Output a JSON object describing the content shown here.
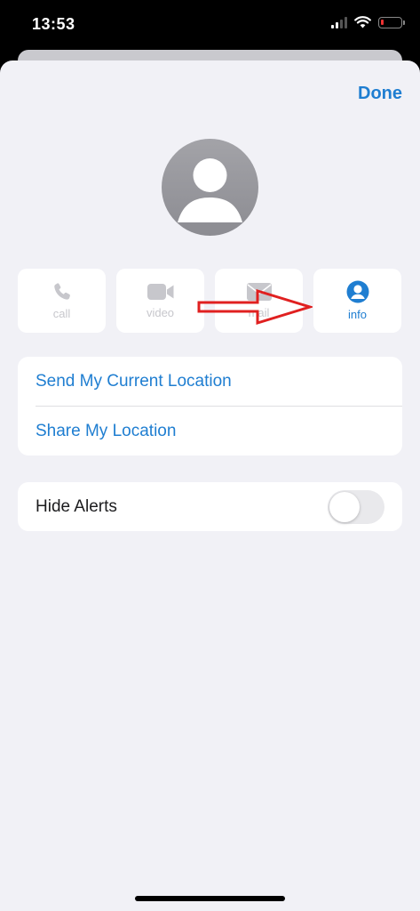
{
  "status_bar": {
    "time": "13:53",
    "icons": [
      "signal-icon",
      "wifi-icon",
      "battery-icon"
    ],
    "battery_color": "#e33333"
  },
  "header": {
    "done_label": "Done"
  },
  "avatar": {
    "icon": "person-silhouette-icon"
  },
  "actions": [
    {
      "label": "call",
      "icon": "phone-icon",
      "enabled": false
    },
    {
      "label": "video",
      "icon": "video-camera-icon",
      "enabled": false
    },
    {
      "label": "mail",
      "icon": "mail-icon",
      "enabled": false
    },
    {
      "label": "info",
      "icon": "person-circle-icon",
      "enabled": true
    }
  ],
  "annotation": {
    "icon": "red-arrow-icon",
    "color": "#e02020"
  },
  "location": {
    "send_current_label": "Send My Current Location",
    "share_label": "Share My Location"
  },
  "alerts": {
    "hide_alerts_label": "Hide Alerts",
    "enabled": false
  },
  "colors": {
    "accent": "#1f7ed1",
    "background": "#f1f1f6",
    "disabled": "#c7c7cc"
  }
}
